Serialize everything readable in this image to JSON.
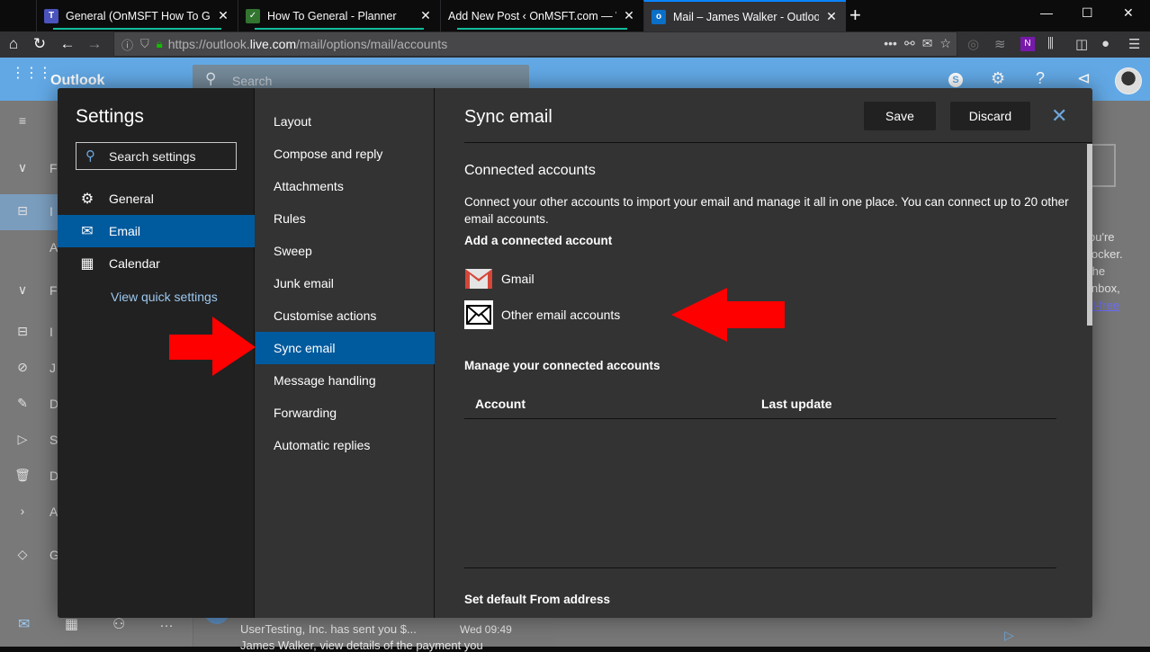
{
  "browser": {
    "tabs": [
      {
        "title": "General (OnMSFT How To Gene",
        "icon": "teams-icon",
        "active": false
      },
      {
        "title": "How To General - Planner",
        "icon": "planner-icon",
        "active": false
      },
      {
        "title": "Add New Post ‹ OnMSFT.com — W",
        "icon": "none",
        "active": false
      },
      {
        "title": "Mail – James Walker - Outlook",
        "icon": "outlook-icon",
        "active": true
      }
    ],
    "close_glyph": "✕",
    "new_tab_glyph": "+",
    "url": {
      "prefix": "https://outlook.",
      "domain": "live.com",
      "path": "/mail/options/mail/accounts"
    },
    "window_controls": {
      "minimize": "—",
      "maximize": "☐",
      "close": "✕"
    }
  },
  "outlook": {
    "brand": "Outlook",
    "search_placeholder": "Search",
    "header_icons": [
      "skype-icon",
      "gear-icon",
      "help-icon",
      "megaphone-icon",
      "avatar"
    ],
    "background_msg": {
      "sender": "UserTesting, Inc. has sent you $...",
      "time": "Wed 09:49",
      "preview": "James Walker, view details of the payment you"
    },
    "background_right_text": [
      "ou're",
      "locker.",
      "the",
      "inbox,"
    ],
    "background_right_link": "d-free"
  },
  "settings": {
    "title": "Settings",
    "search_placeholder": "Search settings",
    "categories": [
      {
        "label": "General",
        "icon": "gear-icon",
        "selected": false
      },
      {
        "label": "Email",
        "icon": "mail-icon",
        "selected": true
      },
      {
        "label": "Calendar",
        "icon": "calendar-icon",
        "selected": false
      }
    ],
    "quick_settings_link": "View quick settings",
    "email_sections": [
      {
        "label": "Layout",
        "selected": false
      },
      {
        "label": "Compose and reply",
        "selected": false
      },
      {
        "label": "Attachments",
        "selected": false
      },
      {
        "label": "Rules",
        "selected": false
      },
      {
        "label": "Sweep",
        "selected": false
      },
      {
        "label": "Junk email",
        "selected": false
      },
      {
        "label": "Customise actions",
        "selected": false
      },
      {
        "label": "Sync email",
        "selected": true
      },
      {
        "label": "Message handling",
        "selected": false
      },
      {
        "label": "Forwarding",
        "selected": false
      },
      {
        "label": "Automatic replies",
        "selected": false
      }
    ],
    "pane": {
      "title": "Sync email",
      "save_label": "Save",
      "discard_label": "Discard",
      "connected_heading": "Connected accounts",
      "connected_description": "Connect your other accounts to import your email and manage it all in one place. You can connect up to 20 other email accounts.",
      "add_heading": "Add a connected account",
      "account_options": [
        {
          "label": "Gmail",
          "icon": "gmail-icon"
        },
        {
          "label": "Other email accounts",
          "icon": "envelope-icon"
        }
      ],
      "manage_heading": "Manage your connected accounts",
      "table_columns": [
        "Account",
        "Last update"
      ],
      "table_rows": [],
      "default_from_heading": "Set default From address"
    }
  },
  "annotations": {
    "arrow_color": "#ff0000"
  }
}
